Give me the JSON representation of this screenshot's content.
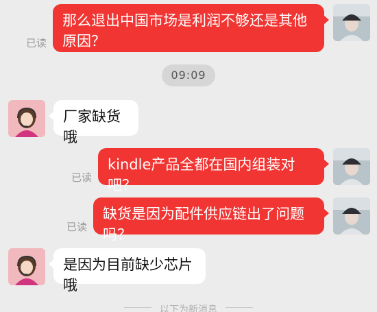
{
  "colors": {
    "background": "#ececec",
    "outgoing_bubble": "#f03533",
    "incoming_bubble": "#ffffff",
    "read_receipt": "#9a9a9a"
  },
  "timestamp": "09:09",
  "messages": [
    {
      "text": "那么退出中国市场是利润不够还是其他原因？",
      "read": "已读"
    },
    {
      "text": "厂家缺货哦"
    },
    {
      "text": "kindle产品全都在国内组装对吧？",
      "read": "已读"
    },
    {
      "text": "缺货是因为配件供应链出了问题吗？",
      "read": "已读"
    },
    {
      "text": "是因为目前缺少芯片哦"
    }
  ],
  "divider_text": "以下为新消息",
  "icons": {
    "self_avatar": "user-avatar-cap-icon",
    "contact_avatar": "support-agent-headset-icon"
  }
}
